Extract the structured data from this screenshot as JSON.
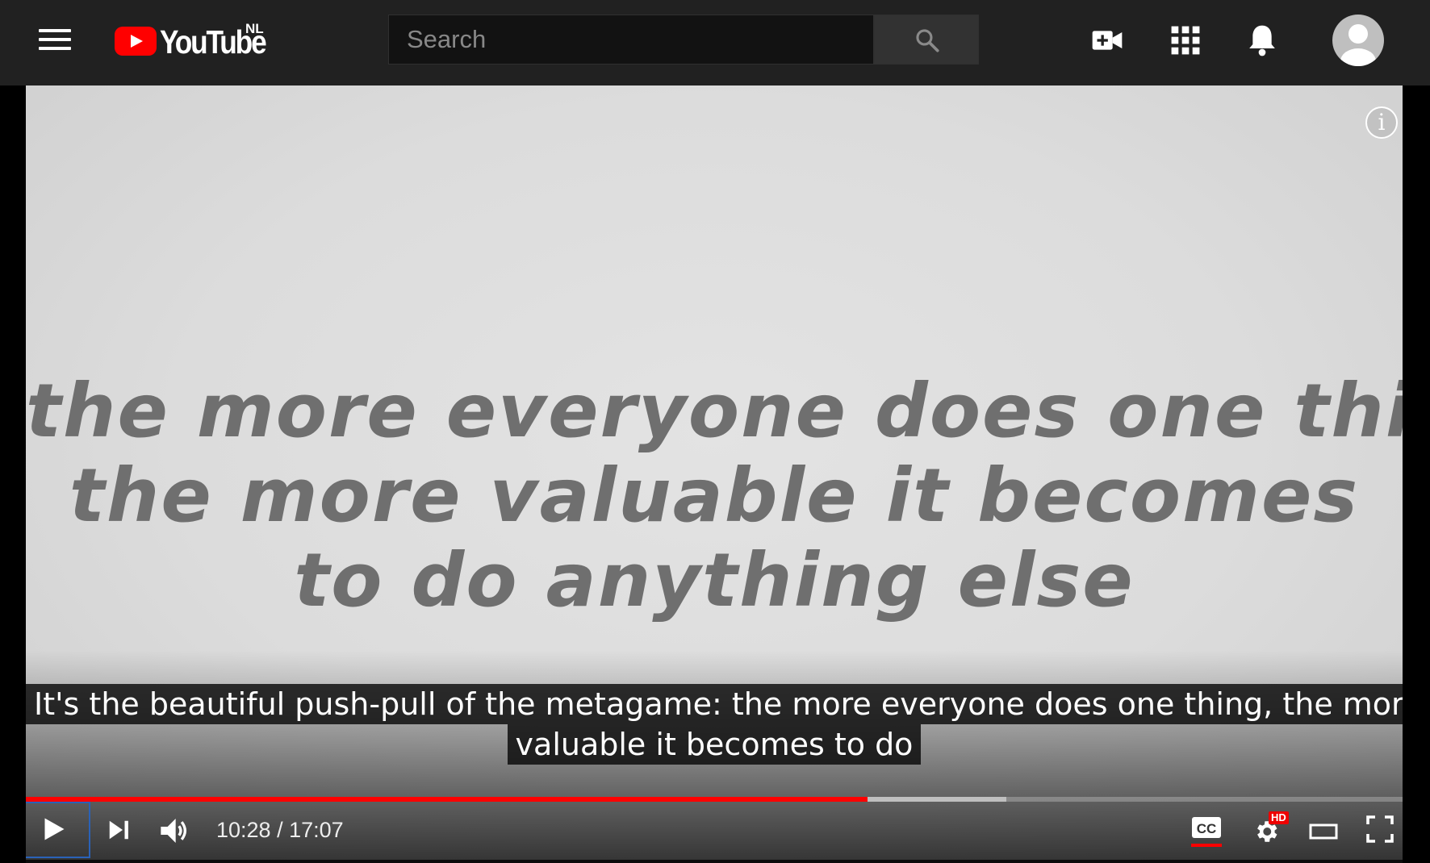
{
  "masthead": {
    "logo_text": "YouTube",
    "country_code": "NL",
    "search_placeholder": "Search"
  },
  "video": {
    "frame_text_lines": [
      "the more everyone does one thing,",
      "the more valuable it becomes",
      "to do anything else"
    ],
    "caption_lines": [
      "It's the beautiful push-pull of the metagame: the more everyone does one thing, the more",
      "valuable it becomes to do"
    ]
  },
  "player_controls": {
    "time_display": "10:28 / 17:07",
    "current_time": "10:28",
    "duration": "17:07",
    "progress_played_fraction": 0.61,
    "progress_buffered_fraction": 0.71,
    "quality_badge": "HD",
    "captions_enabled": true,
    "play_state": "paused"
  },
  "colors": {
    "masthead_bg": "#212121",
    "brand_red": "#ff0000",
    "progress_played": "#ff0000",
    "caption_bg": "#080808"
  },
  "icons": {
    "menu": "hamburger-menu-icon",
    "search": "search-icon",
    "create": "video-camera-plus-icon",
    "apps": "apps-grid-icon",
    "notifications": "bell-icon",
    "account": "avatar-icon",
    "info": "info-icon",
    "play": "play-icon",
    "next": "next-icon",
    "volume": "volume-icon",
    "subtitles": "cc-icon",
    "settings": "gear-icon",
    "theater": "theater-mode-icon",
    "fullscreen": "fullscreen-icon"
  }
}
